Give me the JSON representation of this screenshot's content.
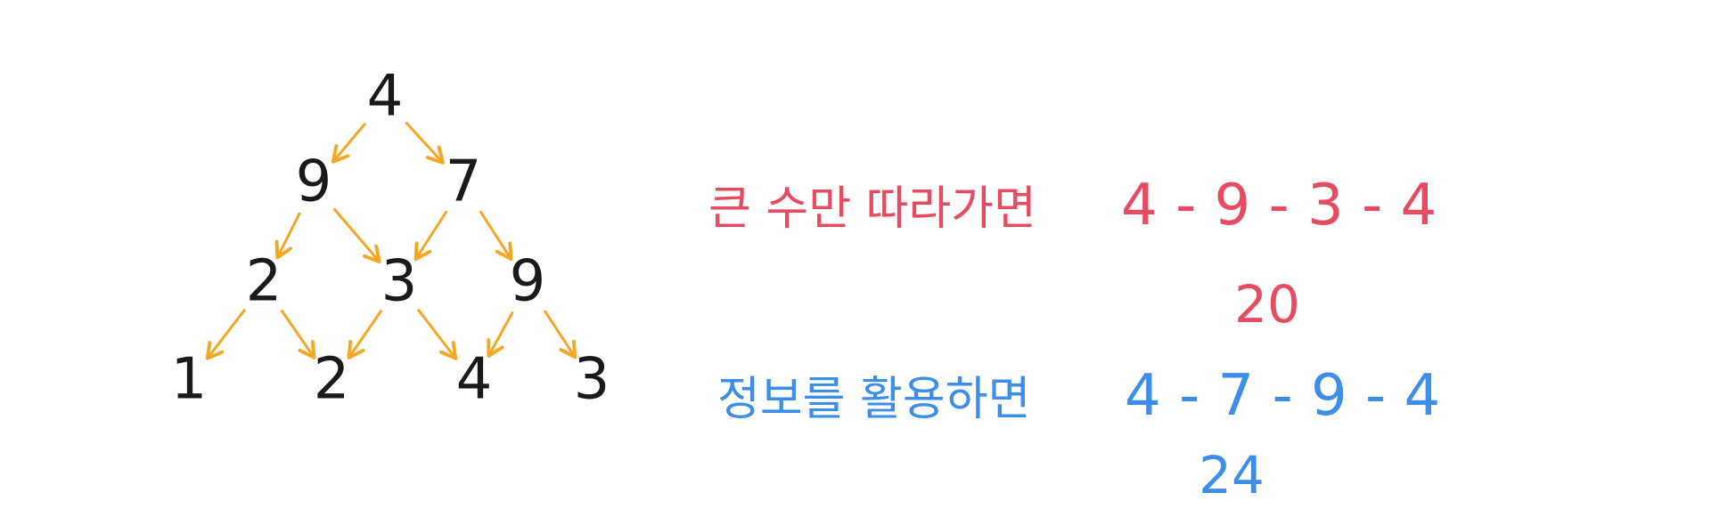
{
  "colors": {
    "arrow": "#f5a623",
    "tree_number": "#1a1a1a",
    "greedy": "#e84a5f",
    "info": "#3d8ee8",
    "background": "#ffffff"
  },
  "tree": {
    "rows": [
      [
        "4"
      ],
      [
        "9",
        "7"
      ],
      [
        "2",
        "3",
        "9"
      ],
      [
        "1",
        "2",
        "4",
        "3"
      ]
    ]
  },
  "greedy": {
    "label": "큰 수만 따라가면",
    "path": "4 - 9 - 3 - 4",
    "sum": "20"
  },
  "info": {
    "label": "정보를 활용하면",
    "path": "4 - 7 - 9 - 4",
    "sum": "24"
  }
}
